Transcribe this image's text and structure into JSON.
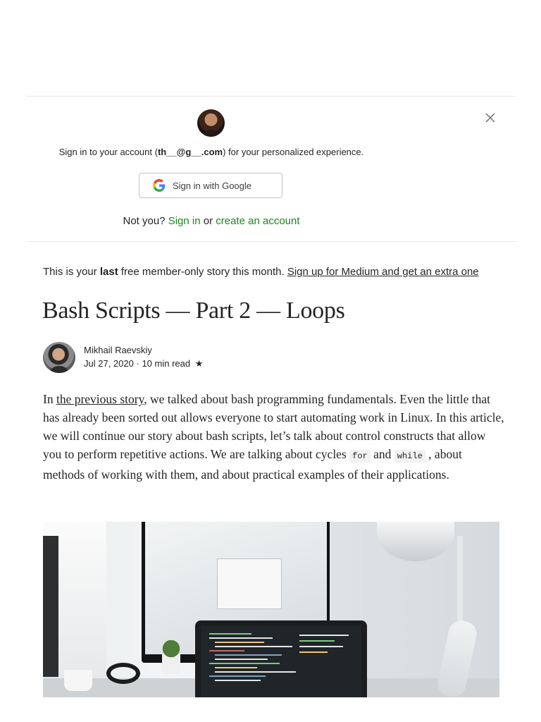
{
  "signin_prompt": {
    "text_prefix": "Sign in to your account (",
    "email": "th__@g__.com",
    "text_suffix": ") for your personalized experience.",
    "google_button_label": "Sign in with Google",
    "not_you": "Not you?",
    "sign_in_link": "Sign in",
    "or": "or",
    "create_account_link": "create an account"
  },
  "member_notice": {
    "prefix": "This is your ",
    "bold": "last",
    "suffix": " free member-only story this month.",
    "link": "Sign up for Medium and get an extra one"
  },
  "article": {
    "title": "Bash Scripts — Part 2 — Loops",
    "author": "Mikhail Raevskiy",
    "date": "Jul 27, 2020",
    "read_time": "10 min read",
    "separator": "·",
    "member_star": "★",
    "body": {
      "p1_start": "In ",
      "link": "the previous story",
      "p1_rest": ", we talked about bash programming fundamentals. Even the little that has already been sorted out allows everyone to start automating work in Linux. In this article, we will continue our story about bash scripts, let’s talk about control constructs that allow you to perform repetitive actions. We are talking about cycles ",
      "code_for": "for",
      "and": " and ",
      "code_while": "while",
      "p1_end": " , about methods of working with them, and about practical examples of their applications."
    }
  },
  "colors": {
    "accent_green": "#1a8917",
    "text": "#242424",
    "divider": "#e6e6e6"
  },
  "icons": [
    "close-icon",
    "google-icon",
    "member-star-icon"
  ]
}
